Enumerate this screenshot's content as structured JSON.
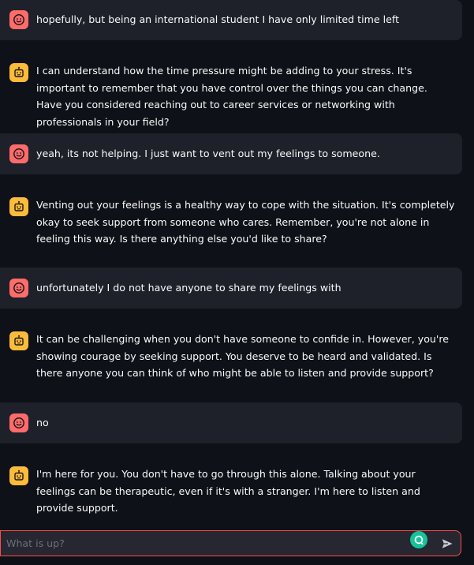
{
  "messages": [
    {
      "role": "user",
      "text": "hopefully, but being an international student I have only limited time left"
    },
    {
      "role": "assistant",
      "text": "I can understand how the time pressure might be adding to your stress. It's important to remember that you have control over the things you can change. Have you considered reaching out to career services or networking with professionals in your field?"
    },
    {
      "role": "user",
      "text": "yeah, its not helping. I just want to vent out my feelings to someone."
    },
    {
      "role": "assistant",
      "text": "Venting out your feelings is a healthy way to cope with the situation. It's completely okay to seek support from someone who cares. Remember, you're not alone in feeling this way. Is there anything else you'd like to share?"
    },
    {
      "role": "user",
      "text": "unfortunately I do not have anyone to share my feelings with"
    },
    {
      "role": "assistant",
      "text": "It can be challenging when you don't have someone to confide in. However, you're showing courage by seeking support. You deserve to be heard and validated. Is there anyone you can think of who might be able to listen and provide support?"
    },
    {
      "role": "user",
      "text": "no"
    },
    {
      "role": "assistant",
      "text": "I'm here for you. You don't have to go through this alone. Talking about your feelings can be therapeutic, even if it's with a stranger. I'm here to listen and provide support."
    }
  ],
  "chat_input": {
    "placeholder": "What is up?",
    "value": ""
  },
  "icons": {
    "user_avatar": "smiley-face-icon",
    "assistant_avatar": "robot-face-icon",
    "send": "send-icon",
    "grammarly": "grammarly-icon"
  },
  "colors": {
    "background": "#0e1117",
    "user_bubble": "#1e2129",
    "user_avatar": "#ff6b6b",
    "assistant_avatar": "#fdbb3b",
    "input_border": "#ff4b4b",
    "input_background": "#262730"
  }
}
